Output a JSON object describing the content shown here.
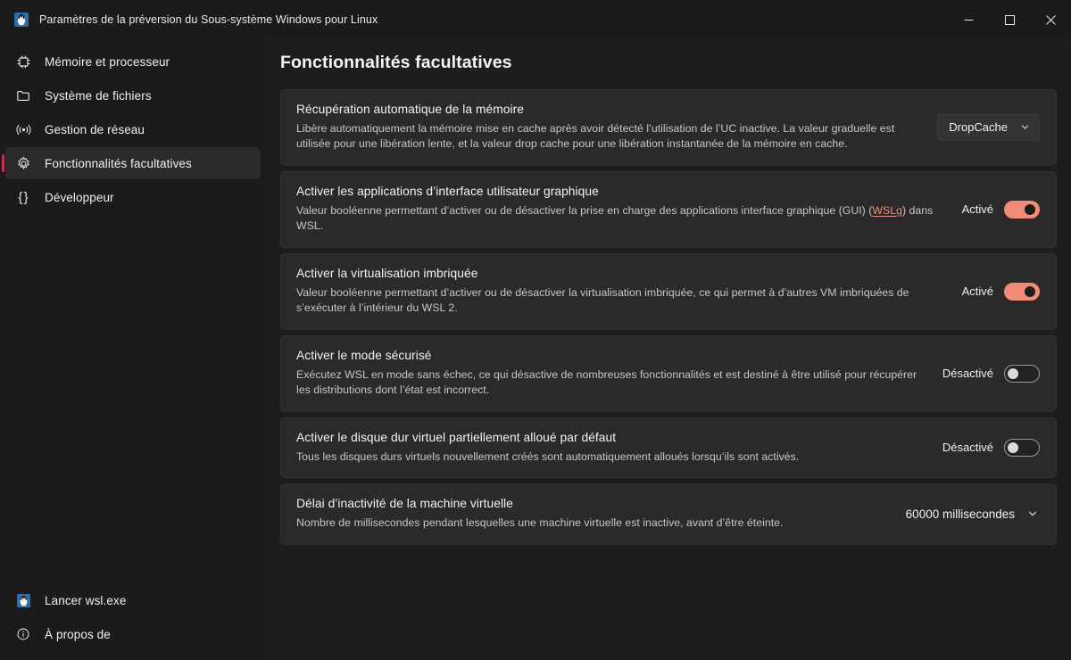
{
  "window": {
    "title": "Paramètres de la préversion du Sous-système Windows pour Linux",
    "app_icon": "tux-penguin-icon",
    "controls": {
      "minimize": "Réduire",
      "maximize": "Agrandir",
      "close": "Fermer"
    }
  },
  "accent": {
    "selection_bar": "#c2344a",
    "toggle_on": "#f08c78",
    "link": "#e99078",
    "card_bg": "#2b2929",
    "page_bg": "#1e1d1d",
    "sidebar_bg": "#1c1b1b"
  },
  "sidebar": {
    "items": [
      {
        "label": "Mémoire et processeur",
        "icon": "cpu-chip-icon",
        "selected": false
      },
      {
        "label": "Système de fichiers",
        "icon": "folder-icon",
        "selected": false
      },
      {
        "label": "Gestion de réseau",
        "icon": "network-signal-icon",
        "selected": false
      },
      {
        "label": "Fonctionnalités facultatives",
        "icon": "gear-icon",
        "selected": true
      },
      {
        "label": "Développeur",
        "icon": "curly-braces-icon",
        "selected": false
      }
    ],
    "bottom_items": [
      {
        "label": "Lancer wsl.exe",
        "icon": "tux-penguin-icon"
      },
      {
        "label": "À propos de",
        "icon": "info-circle-icon"
      }
    ]
  },
  "main": {
    "title": "Fonctionnalités facultatives",
    "settings": [
      {
        "title": "Récupération automatique de la mémoire",
        "desc": "Libère automatiquement la mémoire mise en cache après avoir détecté l’utilisation de l’UC inactive. La valeur graduelle est utilisée pour une libération lente, et la valeur drop cache pour une libération instantanée de la mémoire en cache.",
        "control": "combo",
        "value": "DropCache"
      },
      {
        "title": "Activer les applications d’interface utilisateur graphique",
        "desc_before": "Valeur booléenne permettant d’activer ou de désactiver la prise en charge des applications interface graphique (GUI) (",
        "link": "WSLg",
        "desc_after": ") dans WSL.",
        "control": "toggle",
        "state_label": "Activé",
        "on": true
      },
      {
        "title": "Activer la virtualisation imbriquée",
        "desc": "Valeur booléenne permettant d’activer ou de désactiver la virtualisation imbriquée, ce qui permet à d’autres VM imbriquées de s’exécuter à l’intérieur du WSL 2.",
        "control": "toggle",
        "state_label": "Activé",
        "on": true
      },
      {
        "title": "Activer le mode sécurisé",
        "desc": "Exécutez WSL en mode sans échec, ce qui désactive de nombreuses fonctionnalités et est destiné à être utilisé pour récupérer les distributions dont l’état est incorrect.",
        "control": "toggle",
        "state_label": "Désactivé",
        "on": false
      },
      {
        "title": "Activer le disque dur virtuel partiellement alloué par défaut",
        "desc": "Tous les disques durs virtuels nouvellement créés sont automatiquement alloués lorsqu’ils sont activés.",
        "control": "toggle",
        "state_label": "Désactivé",
        "on": false
      },
      {
        "title": "Délai d’inactivité de la machine virtuelle",
        "desc": "Nombre de millisecondes pendant lesquelles une machine virtuelle est inactive, avant d’être éteinte.",
        "control": "combo-flat",
        "value": "60000 millisecondes"
      }
    ]
  }
}
